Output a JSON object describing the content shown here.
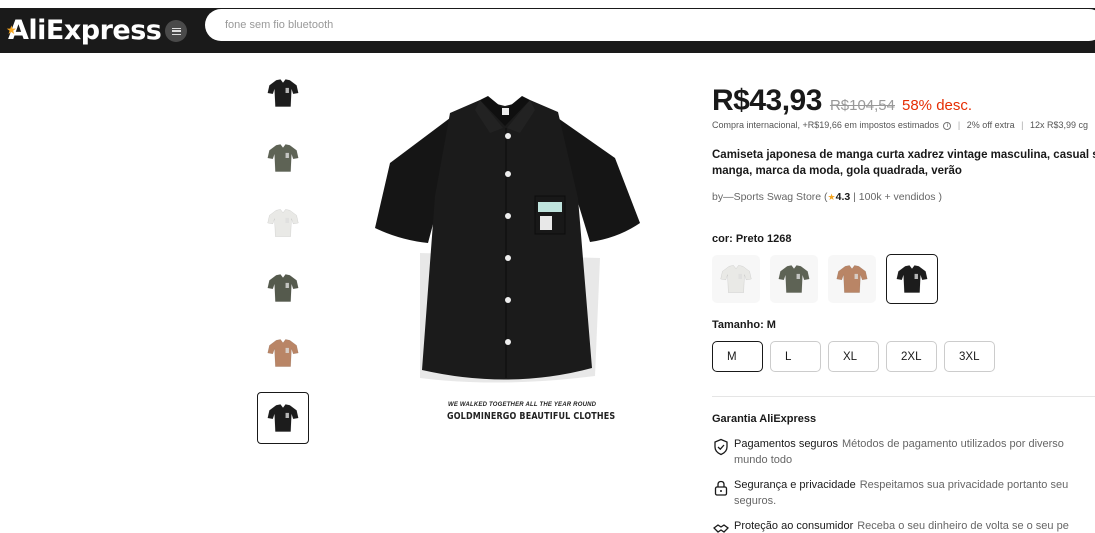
{
  "header": {
    "logo": "AliExpress",
    "search_placeholder": "fone sem fio bluetooth"
  },
  "gallery": {
    "thumbnails": [
      {
        "color": "black",
        "hex": "#1c1c1c"
      },
      {
        "color": "green",
        "hex": "#5e6355"
      },
      {
        "color": "white",
        "hex": "#e9e9e6"
      },
      {
        "color": "dark-green",
        "hex": "#555a4d"
      },
      {
        "color": "brown",
        "hex": "#b98566"
      },
      {
        "color": "black",
        "hex": "#1c1c1c",
        "selected": true
      }
    ],
    "caption_small": "WE WALKED TOGETHER ALL THE YEAR ROUND",
    "caption_main": "GOLDMINERGO   BEAUTIFUL CLOTHES"
  },
  "product": {
    "price": "R$43,93",
    "old_price": "R$104,54",
    "discount": "58% desc.",
    "tax_text": "Compra internacional, +R$19,66 em impostos estimados",
    "extra_off": "2% off extra",
    "installments": "12x R$3,99 cg",
    "title": "Camiseta japonesa de manga curta xadrez vintage masculina, casual s manga, marca da moda, gola quadrada, verão",
    "store_prefix": "by—Sports Swag Store (",
    "rating": "4.3",
    "sold": " | 100k + vendidos )",
    "color_label": "cor: Preto 1268",
    "color_swatches": [
      {
        "name": "white",
        "hex": "#e9e9e6"
      },
      {
        "name": "green",
        "hex": "#5e6355"
      },
      {
        "name": "brown",
        "hex": "#b98566"
      },
      {
        "name": "black",
        "hex": "#1c1c1c",
        "selected": true
      }
    ],
    "size_label": "Tamanho: M",
    "sizes": [
      "M",
      "L",
      "XL",
      "2XL",
      "3XL"
    ],
    "selected_size": "M"
  },
  "guarantee": {
    "title": "Garantia AliExpress",
    "items": [
      {
        "label": "Pagamentos seguros",
        "desc": "Métodos de pagamento utilizados por diverso",
        "desc2": "mundo todo",
        "icon": "shield-check-icon"
      },
      {
        "label": "Segurança e privacidade",
        "desc": "Respeitamos sua privacidade portanto seu",
        "desc2": "seguros.",
        "icon": "lock-icon"
      },
      {
        "label": "Proteção ao consumidor",
        "desc": "Receba o seu dinheiro de volta se o seu pe",
        "desc2": "",
        "icon": "handshake-icon"
      }
    ]
  }
}
